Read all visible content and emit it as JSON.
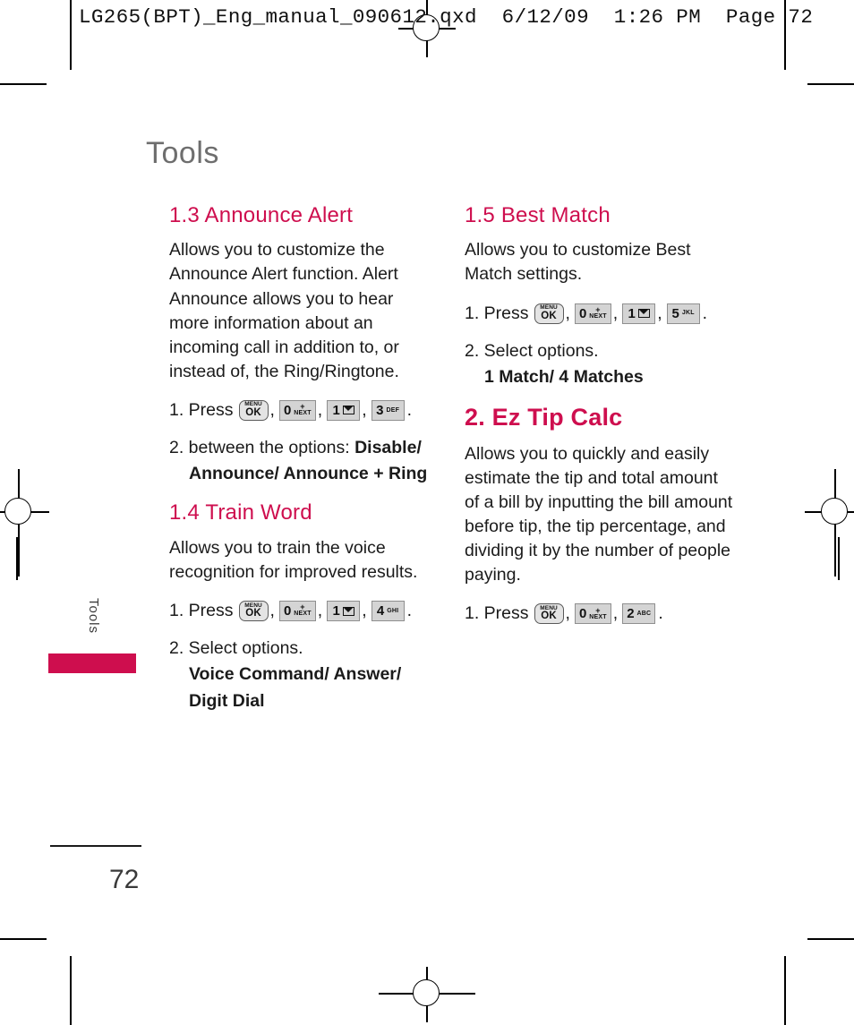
{
  "print_header": "LG265(BPT)_Eng_manual_090612.qxd  6/12/09  1:26 PM  Page 72",
  "page_title": "Tools",
  "side_tab": {
    "label": "Tools"
  },
  "footer": {
    "page_number": "72"
  },
  "colors": {
    "accent": "#ce0e4e",
    "title_gray": "#6e6e6e",
    "body": "#1b1b1b"
  },
  "left_column": {
    "sections": [
      {
        "heading": "1.3 Announce Alert",
        "body": "Allows you to customize the Announce Alert function. Alert Announce allows you to hear more information about an incoming call in addition to, or instead of, the Ring/Ringtone.",
        "press_label": "1. Press",
        "press_keys": [
          {
            "type": "menu",
            "line1": "MENU",
            "line2": "OK"
          },
          {
            "type": "num",
            "digit": "0",
            "sub_top": "+",
            "sub": "NEXT"
          },
          {
            "type": "num",
            "digit": "1",
            "sub": "envelope-icon"
          },
          {
            "type": "num",
            "digit": "3",
            "sub": "DEF"
          }
        ],
        "step2_lead": "2. between the options: ",
        "step2_bold_inline": "Disable/",
        "step2_options": "Announce/ Announce + Ring"
      },
      {
        "heading": "1.4 Train Word",
        "body": "Allows you to train the voice recognition for improved results.",
        "press_label": "1. Press",
        "press_keys": [
          {
            "type": "menu",
            "line1": "MENU",
            "line2": "OK"
          },
          {
            "type": "num",
            "digit": "0",
            "sub_top": "+",
            "sub": "NEXT"
          },
          {
            "type": "num",
            "digit": "1",
            "sub": "envelope-icon"
          },
          {
            "type": "num",
            "digit": "4",
            "sub": "GHI"
          }
        ],
        "step2_lead": "2. Select options.",
        "step2_options": "Voice Command/ Answer/ Digit Dial"
      }
    ]
  },
  "right_column": {
    "sections": [
      {
        "heading": "1.5 Best Match",
        "body": "Allows you to customize Best Match settings.",
        "press_label": "1. Press",
        "press_keys": [
          {
            "type": "menu",
            "line1": "MENU",
            "line2": "OK"
          },
          {
            "type": "num",
            "digit": "0",
            "sub_top": "+",
            "sub": "NEXT"
          },
          {
            "type": "num",
            "digit": "1",
            "sub": "envelope-icon"
          },
          {
            "type": "num",
            "digit": "5",
            "sub": "JKL"
          }
        ],
        "step2_lead": "2. Select options.",
        "step2_options": "1 Match/ 4 Matches"
      },
      {
        "heading": "2. Ez Tip Calc",
        "body": "Allows you to quickly and easily estimate the tip and total amount of a bill by inputting the bill amount before tip, the tip percentage, and dividing it by the number of people paying.",
        "press_label": "1. Press",
        "press_keys": [
          {
            "type": "menu",
            "line1": "MENU",
            "line2": "OK"
          },
          {
            "type": "num",
            "digit": "0",
            "sub_top": "+",
            "sub": "NEXT"
          },
          {
            "type": "num",
            "digit": "2",
            "sub": "ABC"
          }
        ]
      }
    ]
  },
  "punctuation": {
    "comma": ",",
    "period": "."
  }
}
